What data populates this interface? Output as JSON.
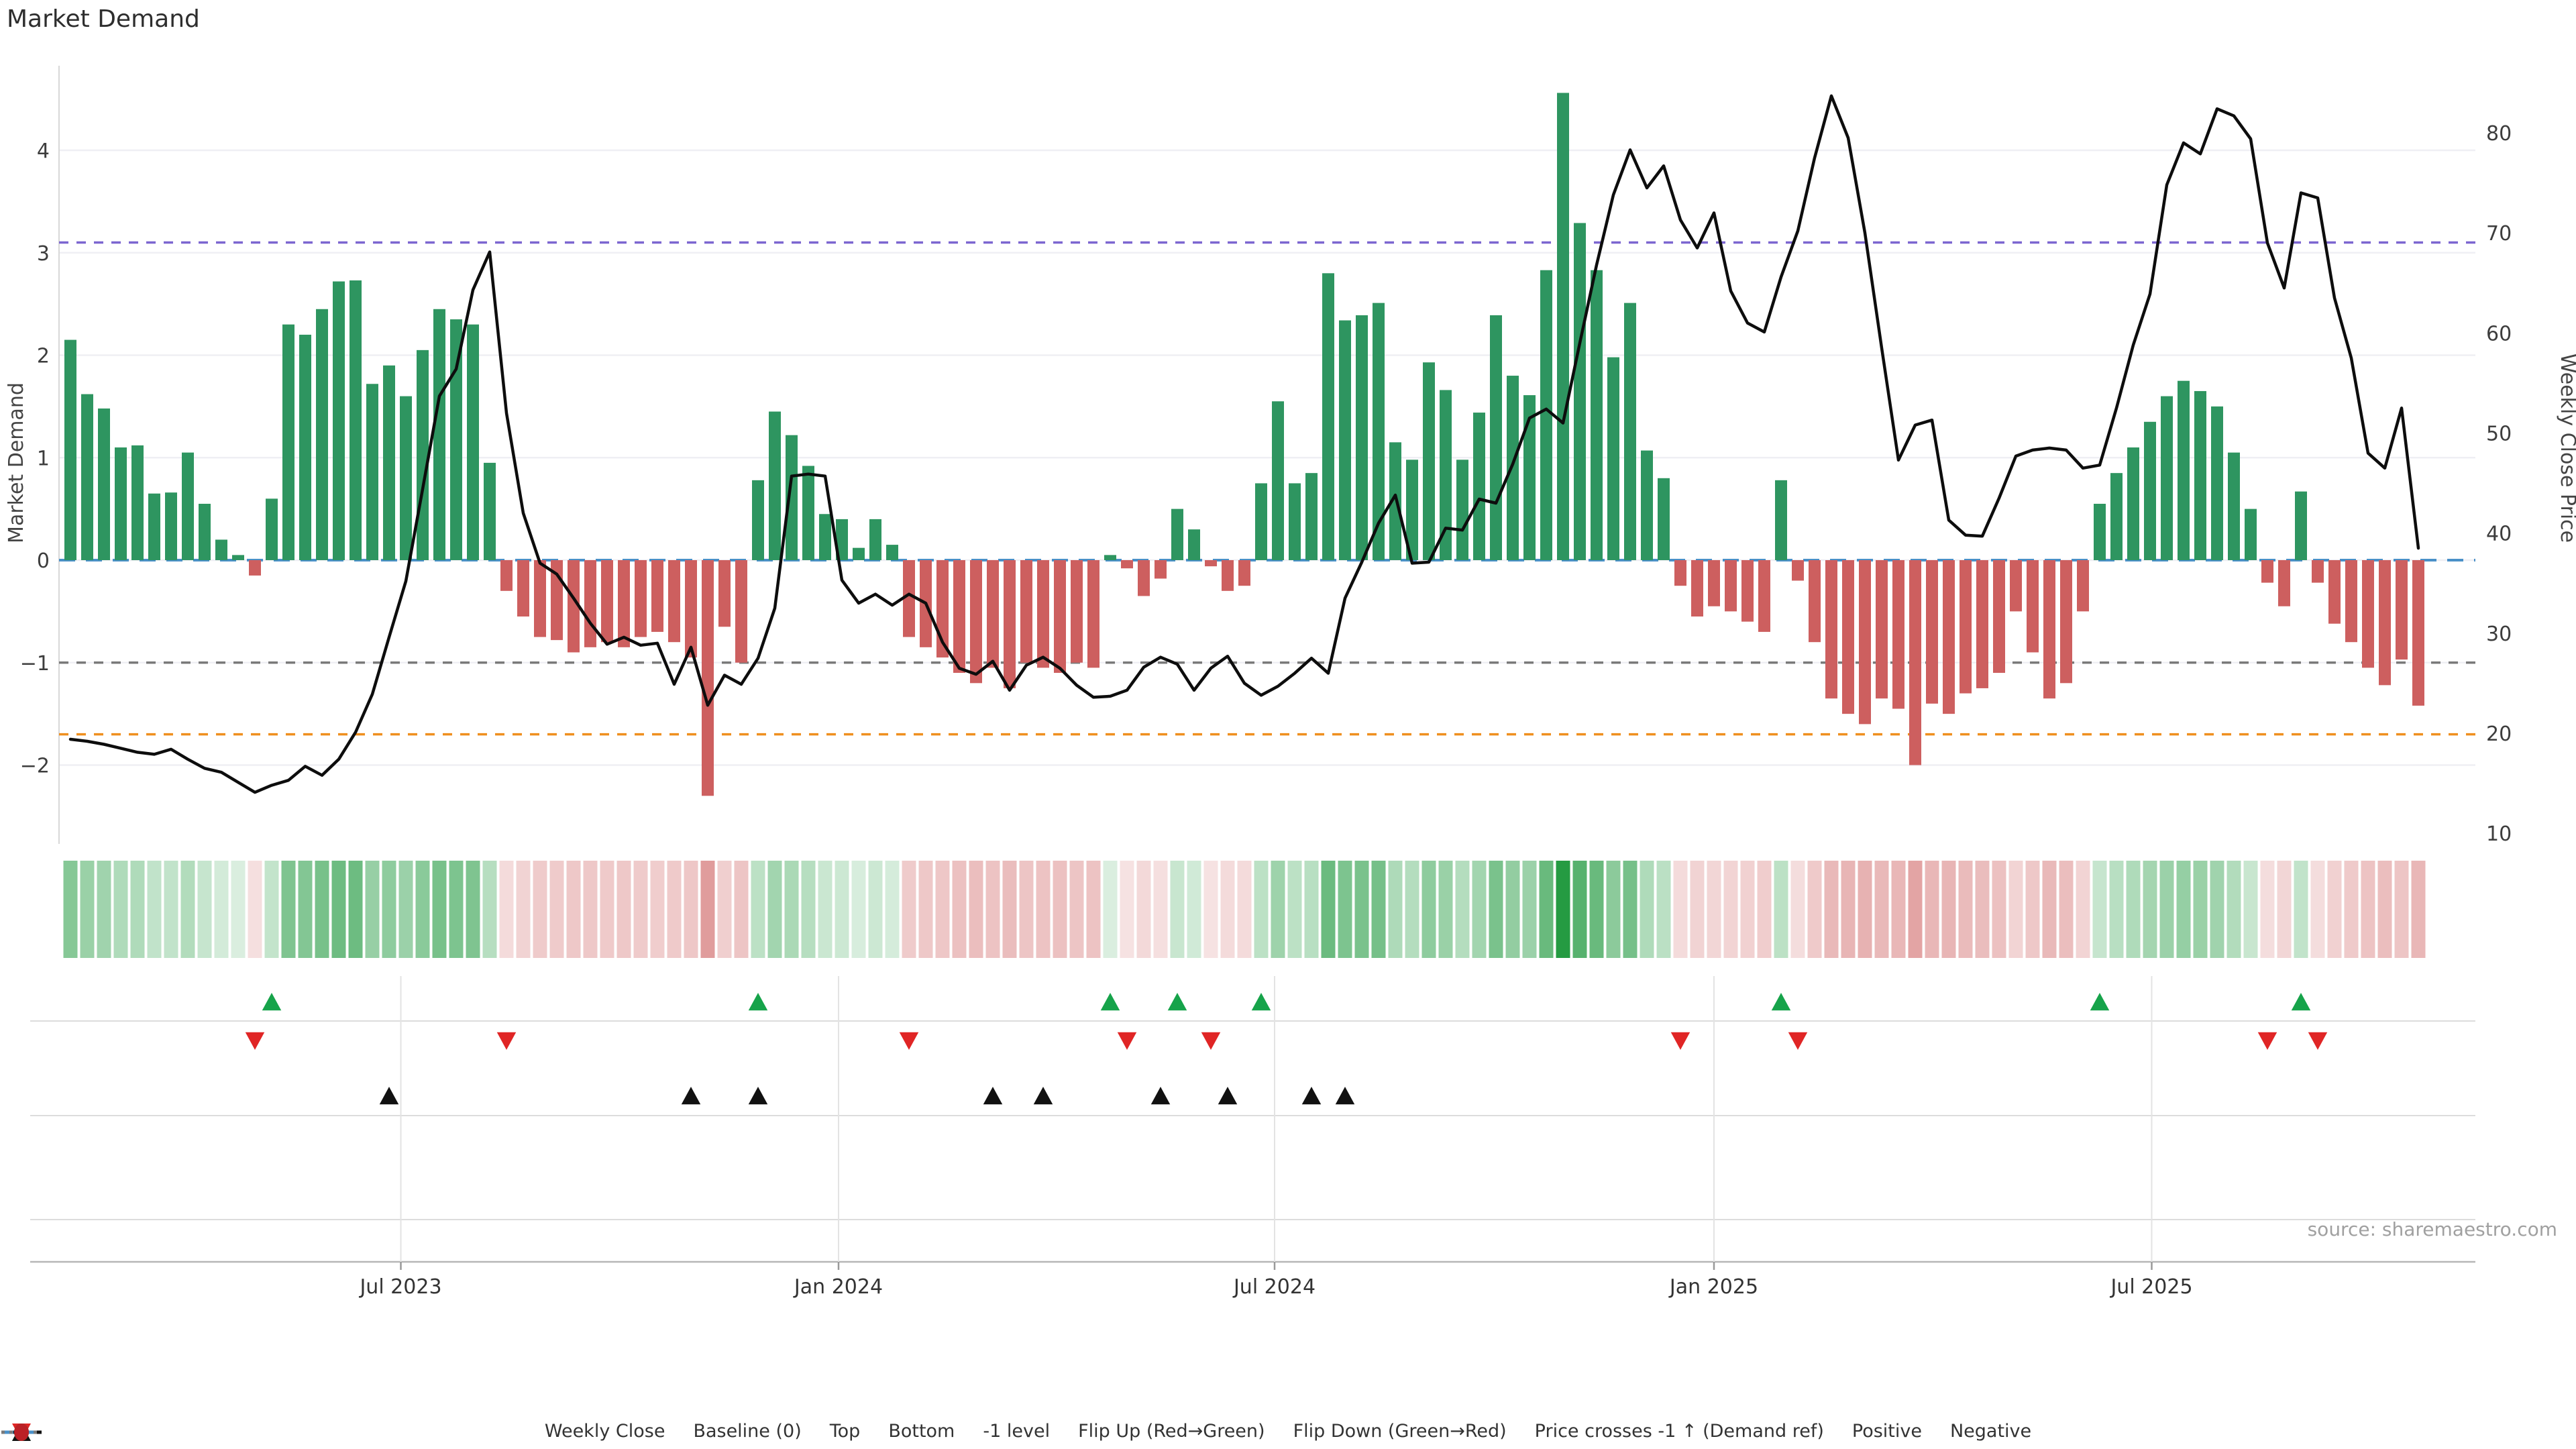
{
  "title": "Market Demand",
  "source_note": "source: sharemaestro.com",
  "axes": {
    "left_label": "Market Demand",
    "right_label": "Weekly Close Price",
    "left_ticks": [
      4,
      3,
      2,
      1,
      0,
      -1,
      -2
    ],
    "right_ticks": [
      80,
      70,
      60,
      50,
      40,
      30,
      20,
      10
    ],
    "x_ticks": [
      {
        "label": "Jul 2023",
        "week": 19.7
      },
      {
        "label": "Jan 2024",
        "week": 45.8
      },
      {
        "label": "Jul 2024",
        "week": 71.8
      },
      {
        "label": "Jan 2025",
        "week": 98.0
      },
      {
        "label": "Jul 2025",
        "week": 124.1
      }
    ]
  },
  "reference_lines": {
    "baseline": 0,
    "top": 3.1,
    "bottom": -1.7,
    "minus_one": -1.0,
    "price_cross_level_price_units": 27.06
  },
  "colors": {
    "bar_positive": "#2e9560",
    "bar_negative": "#cd5f5f",
    "price_line": "#0d0d0d",
    "baseline": "#4a90c8",
    "top_line": "#7c66d0",
    "bottom_line": "#ef8f1f",
    "minus_one_line": "#7a7a7a",
    "flip_up": "#16a34a",
    "flip_down": "#e02525",
    "price_cross": "#111111",
    "heat_green": "#229a40",
    "heat_red": "#ca5454",
    "grid": "#efeff4",
    "band_grid": "#dcdcdc",
    "axis_line": "#b6b6b6"
  },
  "chart_data": {
    "type": "combo",
    "title": "Market Demand",
    "xlabel": "",
    "ylabel_left": "Market Demand",
    "ylabel_right": "Weekly Close Price",
    "x_unit": "week",
    "ylim_left": [
      -2.77,
      4.81
    ],
    "ylim_right": [
      7.5,
      87.0
    ],
    "axis_mapping": "price = 37.3 + 10.24 * demand",
    "grid": "horizontal at integer demand levels",
    "legend_position": "bottom center",
    "series": [
      {
        "name": "Market Demand",
        "type": "bar",
        "axis": "left",
        "values": [
          2.15,
          1.62,
          1.48,
          1.1,
          1.12,
          0.65,
          0.66,
          1.05,
          0.55,
          0.2,
          0.05,
          -0.15,
          0.6,
          2.3,
          2.2,
          2.45,
          2.72,
          2.73,
          1.72,
          1.9,
          1.6,
          2.05,
          2.45,
          2.35,
          2.3,
          0.95,
          -0.3,
          -0.55,
          -0.75,
          -0.78,
          -0.9,
          -0.85,
          -0.8,
          -0.85,
          -0.75,
          -0.7,
          -0.8,
          -0.95,
          -2.3,
          -0.65,
          -1.0,
          0.78,
          1.45,
          1.22,
          0.92,
          0.45,
          0.4,
          0.12,
          0.4,
          0.15,
          -0.75,
          -0.85,
          -0.95,
          -1.1,
          -1.2,
          -1.05,
          -1.25,
          -1.0,
          -1.05,
          -1.1,
          -1.0,
          -1.05,
          0.05,
          -0.08,
          -0.35,
          -0.18,
          0.5,
          0.3,
          -0.06,
          -0.3,
          -0.25,
          0.75,
          1.55,
          0.75,
          0.85,
          2.8,
          2.34,
          2.39,
          2.51,
          1.15,
          0.98,
          1.93,
          1.66,
          0.98,
          1.44,
          2.39,
          1.8,
          1.61,
          2.83,
          4.56,
          3.29,
          2.83,
          1.98,
          2.51,
          1.07,
          0.8,
          -0.25,
          -0.55,
          -0.45,
          -0.5,
          -0.6,
          -0.7,
          0.78,
          -0.2,
          -0.8,
          -1.35,
          -1.5,
          -1.6,
          -1.35,
          -1.45,
          -2.0,
          -1.4,
          -1.5,
          -1.3,
          -1.25,
          -1.1,
          -0.5,
          -0.9,
          -1.35,
          -1.2,
          -0.5,
          0.55,
          0.85,
          1.1,
          1.35,
          1.6,
          1.75,
          1.65,
          1.5,
          1.05,
          0.5,
          -0.22,
          -0.45,
          0.67,
          -0.22,
          -0.62,
          -0.8,
          -1.05,
          -1.22,
          -0.97,
          -1.42
        ]
      },
      {
        "name": "Weekly Close",
        "type": "line",
        "axis": "right",
        "values": [
          19.4,
          19.2,
          18.9,
          18.5,
          18.1,
          17.9,
          18.4,
          17.4,
          16.5,
          16.1,
          15.1,
          14.1,
          14.8,
          15.3,
          16.7,
          15.8,
          17.4,
          20.1,
          23.9,
          29.6,
          35.2,
          44.4,
          53.7,
          56.4,
          64.3,
          68.1,
          52.0,
          42.0,
          37.0,
          35.9,
          33.5,
          31.0,
          28.9,
          29.6,
          28.8,
          29.0,
          24.9,
          28.6,
          22.8,
          25.8,
          24.9,
          27.5,
          32.5,
          45.7,
          45.9,
          45.7,
          35.3,
          33.0,
          33.9,
          32.8,
          33.9,
          33.0,
          29.1,
          26.5,
          25.9,
          27.2,
          24.3,
          26.8,
          27.6,
          26.5,
          24.8,
          23.6,
          23.7,
          24.3,
          26.6,
          27.6,
          26.9,
          24.3,
          26.5,
          27.7,
          25.0,
          23.8,
          24.7,
          26.0,
          27.5,
          26.0,
          33.5,
          37.1,
          41.0,
          43.8,
          37.0,
          37.1,
          40.5,
          40.3,
          43.4,
          43.0,
          46.9,
          51.5,
          52.4,
          51.0,
          59.0,
          66.8,
          73.8,
          78.3,
          74.5,
          76.7,
          71.3,
          68.5,
          72.0,
          64.2,
          61.0,
          60.1,
          65.6,
          70.2,
          77.5,
          83.7,
          79.5,
          70.0,
          58.5,
          47.3,
          50.8,
          51.3,
          41.3,
          39.8,
          39.7,
          43.5,
          47.7,
          48.3,
          48.5,
          48.3,
          46.5,
          46.8,
          52.5,
          58.8,
          63.9,
          74.8,
          79.0,
          77.9,
          82.4,
          81.7,
          79.4,
          69.0,
          64.5,
          74.0,
          73.5,
          63.5,
          57.5,
          48.0,
          46.5,
          52.5,
          38.5
        ]
      }
    ],
    "heatmap": {
      "description": "weekly strip below main chart; green cells for positive demand, red cells for negative demand, opacity scales with magnitude",
      "derived_from": "Market Demand series"
    },
    "marker_rows": [
      {
        "name": "Flip Up (Red→Green)",
        "rule": "first positive demand week after negative"
      },
      {
        "name": "Flip Down (Green→Red)",
        "rule": "first negative demand week after positive"
      },
      {
        "name": "Price crosses -1 ↑ (Demand ref)",
        "rule": "price crosses above demand -1 level (≈27.06) upward"
      }
    ]
  },
  "legend": {
    "items": [
      {
        "label": "Weekly Close",
        "swatch": "line",
        "color": "#111111"
      },
      {
        "label": "Baseline (0)",
        "swatch": "dashed-line",
        "color": "#4a90c8"
      },
      {
        "label": "Top",
        "swatch": "dotted-line",
        "color": "#7c66d0"
      },
      {
        "label": "Bottom",
        "swatch": "dotted-line",
        "color": "#ef8f1f"
      },
      {
        "label": "-1 level",
        "swatch": "dotted-line",
        "color": "#7a7a7a"
      },
      {
        "label": "Flip Up (Red→Green)",
        "swatch": "triangle-up",
        "color": "#16a34a"
      },
      {
        "label": "Flip Down (Green→Red)",
        "swatch": "triangle-down",
        "color": "#e02525"
      },
      {
        "label": "Price crosses -1 ↑ (Demand ref)",
        "swatch": "triangle-up",
        "color": "#111111"
      },
      {
        "label": "Positive",
        "swatch": "circle",
        "color": "#168039"
      },
      {
        "label": "Negative",
        "swatch": "circle",
        "color": "#bb2026"
      }
    ]
  }
}
